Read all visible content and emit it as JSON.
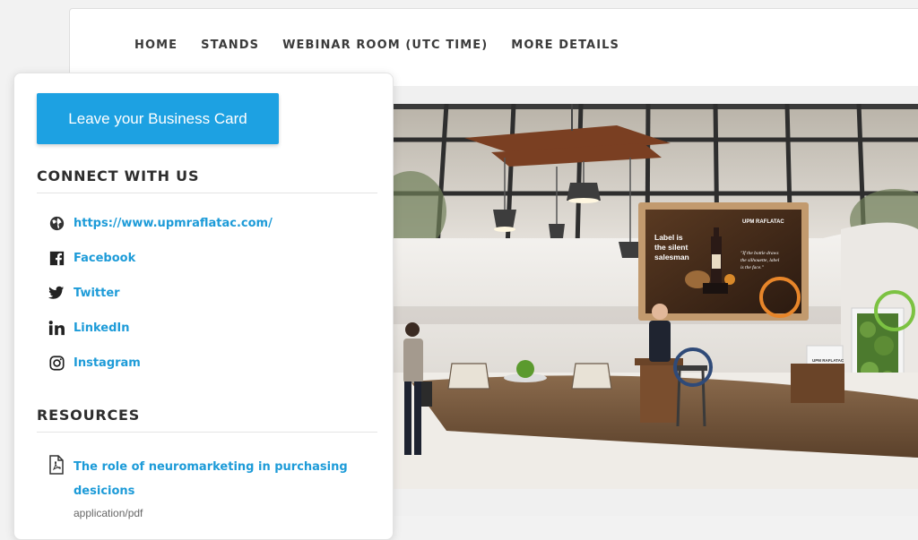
{
  "nav": {
    "items": [
      "HOME",
      "STANDS",
      "WEBINAR ROOM (UTC TIME)",
      "MORE DETAILS"
    ]
  },
  "sidebar": {
    "business_card_label": "Leave your Business Card",
    "connect_title": "CONNECT WITH US",
    "links": [
      {
        "icon": "globe-icon",
        "label": "https://www.upmraflatac.com/"
      },
      {
        "icon": "facebook-icon",
        "label": "Facebook"
      },
      {
        "icon": "twitter-icon",
        "label": "Twitter"
      },
      {
        "icon": "linkedin-icon",
        "label": "LinkedIn"
      },
      {
        "icon": "instagram-icon",
        "label": "Instagram"
      }
    ],
    "resources_title": "RESOURCES",
    "resources": [
      {
        "icon": "pdf-icon",
        "title": "The role of neuromarketing in purchasing desicions",
        "type": "application/pdf"
      }
    ]
  },
  "booth": {
    "screen_brand": "UPM RAFLATAC",
    "screen_headline": "Label is the silent salesman",
    "screen_quote": "\"If the bottle draws the silhouette, label is the face.\"",
    "counter_brand": "UPM RAFLATAC",
    "hotspot_colors": [
      "#e8862a",
      "#7cc242",
      "#2f4a78"
    ]
  },
  "colors": {
    "accent": "#1da1e2",
    "link": "#1d9bd8",
    "heading": "#2d2d2d"
  }
}
